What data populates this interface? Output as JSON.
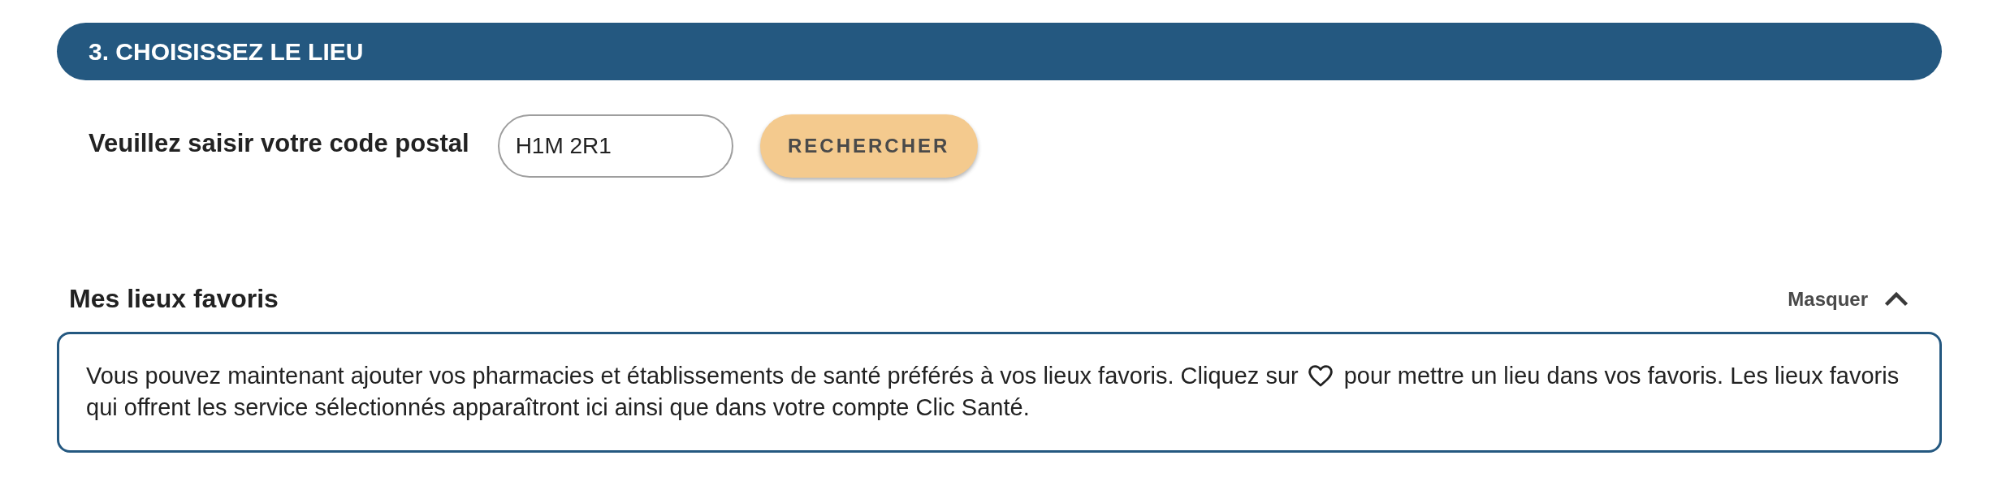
{
  "section_header": {
    "title": "3. CHOISISSEZ LE LIEU"
  },
  "postal_search": {
    "label": "Veuillez saisir votre code postal",
    "input": {
      "value": "H1M 2R1"
    },
    "button": "RECHERCHER"
  },
  "favorites": {
    "title": "Mes lieux favoris",
    "toggle_label": "Masquer",
    "expanded": true,
    "text_before": "Vous pouvez maintenant ajouter vos pharmacies et établissements de santé préférés à vos lieux favoris. Cliquez sur",
    "text_after": "pour mettre un lieu dans vos favoris. Les lieux favoris qui offrent les service sélectionnés apparaîtront ici ainsi que dans votre compte Clic Santé."
  }
}
